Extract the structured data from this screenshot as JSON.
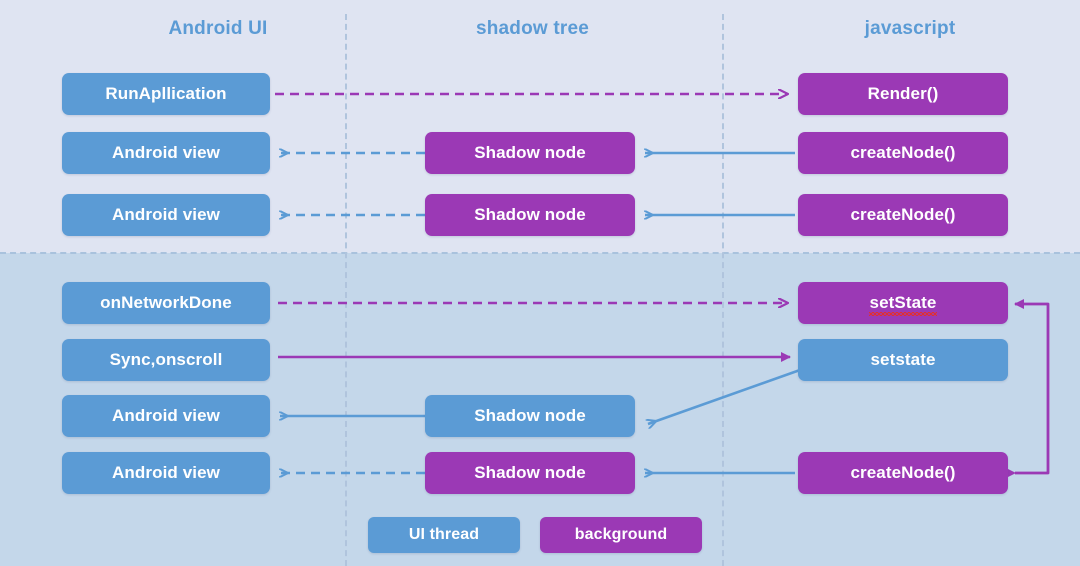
{
  "diagram": {
    "title_columns": [
      {
        "label": "Android UI"
      },
      {
        "label": "shadow tree"
      },
      {
        "label": "javascript"
      }
    ],
    "colors": {
      "ui_thread_blue": "#5b9bd5",
      "background_purple": "#9b39b5",
      "band_top": "#dfe4f2",
      "band_bottom": "#c4d7ea",
      "lane_separator": "#b0c4dd",
      "spellcheck_underline": "#e03030"
    },
    "nodes": {
      "run_application": "RunApllication",
      "render": "Render()",
      "android_view_1": "Android view",
      "shadow_node_1": "Shadow node",
      "create_node_1": "createNode()",
      "android_view_2": "Android view",
      "shadow_node_2": "Shadow node",
      "create_node_2": "createNode()",
      "on_network_done": "onNetworkDone",
      "set_state": "setState",
      "sync_onscroll": "Sync,onscroll",
      "setstate_lower": "setstate",
      "android_view_3": "Android view",
      "shadow_node_3": "Shadow node",
      "android_view_4": "Android view",
      "shadow_node_4": "Shadow node",
      "create_node_3": "createNode()"
    },
    "legend": {
      "ui_thread": "UI thread",
      "background": "background"
    }
  }
}
